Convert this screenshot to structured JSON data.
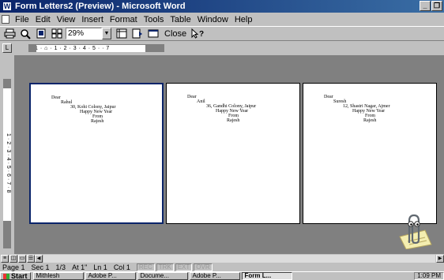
{
  "window": {
    "title": "Form Letters2 (Preview) - Microsoft Word",
    "minimize": "_",
    "restore": "❐"
  },
  "menu": [
    "File",
    "Edit",
    "View",
    "Insert",
    "Format",
    "Tools",
    "Table",
    "Window",
    "Help"
  ],
  "toolbar": {
    "zoom": "29%",
    "close_label": "Close"
  },
  "ruler": {
    "marks": "1 · ⌂ · 1 · 2 · 3 · 4 · 5 · · 7"
  },
  "pages": [
    {
      "dear": "Dear",
      "name": "Rahul",
      "address": "30, Kohi Colony, Jaipur",
      "greeting": "Happy New Year",
      "from": "From",
      "sender": "Rajesh"
    },
    {
      "dear": "Dear",
      "name": "Anil",
      "address": "36, Gandhi Colony, Jaipur",
      "greeting": "Happy New Year",
      "from": "From",
      "sender": "Rajesh"
    },
    {
      "dear": "Dear",
      "name": "Suresh",
      "address": "12, Shastri Nagar, Ajmer",
      "greeting": "Happy New Year",
      "from": "From",
      "sender": "Rajesh"
    }
  ],
  "status": {
    "page": "Page 1",
    "sec": "Sec 1",
    "count": "1/3",
    "at": "At 1\"",
    "ln": "Ln 1",
    "col": "Col 1",
    "rec": "REC",
    "trk": "TRK",
    "ext": "EXT",
    "ovr": "OVR"
  },
  "taskbar": {
    "start": "Start",
    "tasks": [
      "Mithlesh",
      "Adobe P...",
      "Docume...",
      "Adobe P...",
      "Form L..."
    ],
    "clock": "1:09 PM"
  }
}
